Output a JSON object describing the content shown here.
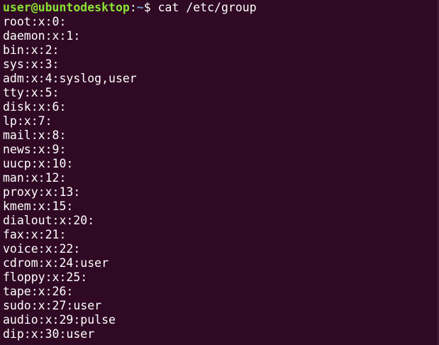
{
  "colors": {
    "background": "#300a24",
    "foreground": "#ffffff",
    "prompt_user": "#8ae234",
    "prompt_path": "#729fcf"
  },
  "prompt": {
    "user_host": "user@ubuntodesktop",
    "separator": ":",
    "path": "~",
    "symbol": "$ ",
    "command": "cat /etc/group"
  },
  "output_lines": [
    "root:x:0:",
    "daemon:x:1:",
    "bin:x:2:",
    "sys:x:3:",
    "adm:x:4:syslog,user",
    "tty:x:5:",
    "disk:x:6:",
    "lp:x:7:",
    "mail:x:8:",
    "news:x:9:",
    "uucp:x:10:",
    "man:x:12:",
    "proxy:x:13:",
    "kmem:x:15:",
    "dialout:x:20:",
    "fax:x:21:",
    "voice:x:22:",
    "cdrom:x:24:user",
    "floppy:x:25:",
    "tape:x:26:",
    "sudo:x:27:user",
    "audio:x:29:pulse",
    "dip:x:30:user"
  ]
}
